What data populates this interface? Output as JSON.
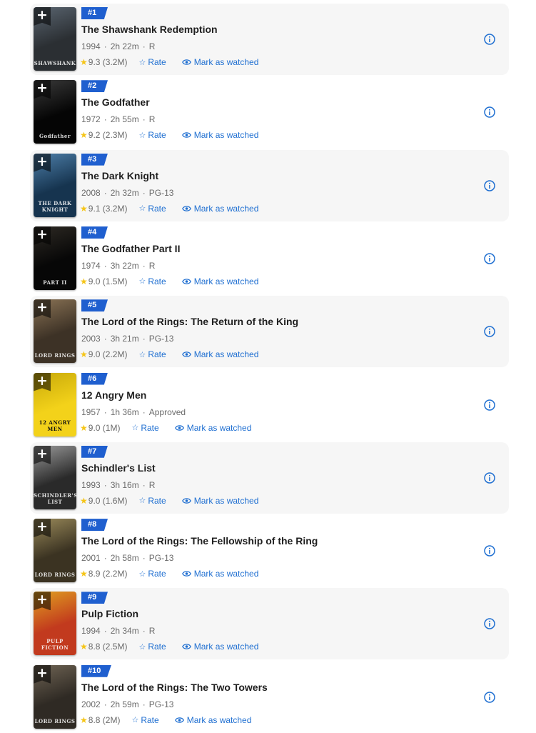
{
  "actions": {
    "rate_label": "Rate",
    "watch_label": "Mark as watched"
  },
  "movies": [
    {
      "rank": "#1",
      "title": "The Shawshank Redemption",
      "year": "1994",
      "runtime": "2h 22m",
      "cert": "R",
      "rating": "9.3",
      "votes": "(3.2M)",
      "poster_caption": "SHAWSHANK",
      "poster_colors": [
        "#2b2f33",
        "#5a6570"
      ]
    },
    {
      "rank": "#2",
      "title": "The Godfather",
      "year": "1972",
      "runtime": "2h 55m",
      "cert": "R",
      "rating": "9.2",
      "votes": "(2.3M)",
      "poster_caption": "Godfather",
      "poster_colors": [
        "#050505",
        "#3a3a3a"
      ]
    },
    {
      "rank": "#3",
      "title": "The Dark Knight",
      "year": "2008",
      "runtime": "2h 32m",
      "cert": "PG-13",
      "rating": "9.1",
      "votes": "(3.2M)",
      "poster_caption": "THE DARK KNIGHT",
      "poster_colors": [
        "#16344f",
        "#4d7ea8"
      ]
    },
    {
      "rank": "#4",
      "title": "The Godfather Part II",
      "year": "1974",
      "runtime": "3h 22m",
      "cert": "R",
      "rating": "9.0",
      "votes": "(1.5M)",
      "poster_caption": "PART II",
      "poster_colors": [
        "#070707",
        "#2e2a24"
      ]
    },
    {
      "rank": "#5",
      "title": "The Lord of the Rings: The Return of the King",
      "year": "2003",
      "runtime": "3h 21m",
      "cert": "PG-13",
      "rating": "9.0",
      "votes": "(2.2M)",
      "poster_caption": "LORD RINGS",
      "poster_colors": [
        "#3d3226",
        "#8a7355"
      ]
    },
    {
      "rank": "#6",
      "title": "12 Angry Men",
      "year": "1957",
      "runtime": "1h 36m",
      "cert": "Approved",
      "rating": "9.0",
      "votes": "(1M)",
      "poster_caption": "12 ANGRY MEN",
      "poster_colors": [
        "#f3d21a",
        "#c8a90a"
      ]
    },
    {
      "rank": "#7",
      "title": "Schindler's List",
      "year": "1993",
      "runtime": "3h 16m",
      "cert": "R",
      "rating": "9.0",
      "votes": "(1.6M)",
      "poster_caption": "SCHINDLER'S LIST",
      "poster_colors": [
        "#2a2a2a",
        "#9a9a9a"
      ]
    },
    {
      "rank": "#8",
      "title": "The Lord of the Rings: The Fellowship of the Ring",
      "year": "2001",
      "runtime": "2h 58m",
      "cert": "PG-13",
      "rating": "8.9",
      "votes": "(2.2M)",
      "poster_caption": "LORD RINGS",
      "poster_colors": [
        "#3b3322",
        "#9a8a5a"
      ]
    },
    {
      "rank": "#9",
      "title": "Pulp Fiction",
      "year": "1994",
      "runtime": "2h 34m",
      "cert": "R",
      "rating": "8.8",
      "votes": "(2.5M)",
      "poster_caption": "PULP FICTION",
      "poster_colors": [
        "#c23a1e",
        "#e0a020"
      ]
    },
    {
      "rank": "#10",
      "title": "The Lord of the Rings: The Two Towers",
      "year": "2002",
      "runtime": "2h 59m",
      "cert": "PG-13",
      "rating": "8.8",
      "votes": "(2M)",
      "poster_caption": "LORD RINGS",
      "poster_colors": [
        "#2f2a24",
        "#6f6454"
      ]
    }
  ],
  "colors": {
    "rank_badge": "#1f5fcf",
    "link": "#1f6fd1",
    "star": "#f5c518",
    "row_shade": "#f6f6f6"
  },
  "icons": {
    "add": "plus-icon",
    "star": "star-icon",
    "rate": "star-outline-icon",
    "watch": "eye-icon",
    "info": "info-circle-icon"
  }
}
